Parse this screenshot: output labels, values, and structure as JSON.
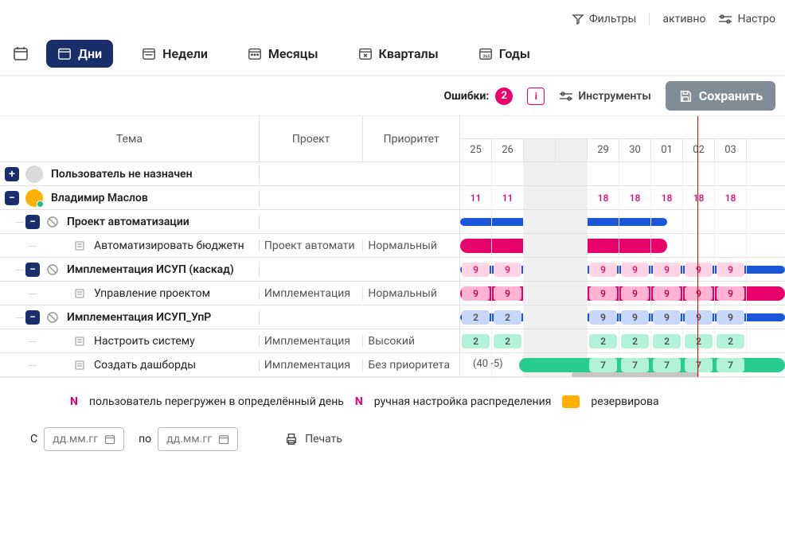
{
  "topbar": {
    "filters": "Фильтры",
    "active": "активно",
    "settings": "Настро"
  },
  "tabs": {
    "days": "Дни",
    "weeks": "Недели",
    "months": "Месяцы",
    "quarters": "Кварталы",
    "years": "Годы"
  },
  "toolrow": {
    "errors_label": "Ошибки:",
    "errors_count": "2",
    "tools": "Инструменты",
    "save": "Сохранить"
  },
  "headers": {
    "topic": "Тема",
    "project": "Проект",
    "priority": "Приоритет"
  },
  "days": [
    "25",
    "26",
    "",
    "",
    "29",
    "30",
    "01",
    "02",
    "03"
  ],
  "weekend_cols": [
    2,
    3
  ],
  "rows": {
    "r0": {
      "title": "Пользователь не назначен"
    },
    "r1": {
      "title": "Владимир Маслов",
      "alloc": [
        "11",
        "11",
        "",
        "",
        "18",
        "18",
        "18",
        "18",
        "18"
      ]
    },
    "r2": {
      "title": "Проект автоматизации"
    },
    "r3": {
      "title": "Автоматизировать бюджетн",
      "project": "Проект автомати",
      "priority": "Нормальный"
    },
    "r4": {
      "title": "Имплементация ИСУП (каскад)",
      "alloc": [
        "9",
        "9",
        "",
        "",
        "9",
        "9",
        "9",
        "9",
        "9"
      ]
    },
    "r5": {
      "title": "Управление проектом",
      "project": "Имплементация",
      "priority": "Нормальный",
      "alloc": [
        "9",
        "9",
        "",
        "",
        "9",
        "9",
        "9",
        "9",
        "9"
      ]
    },
    "r6": {
      "title": "Имплементация ИСУП_УпР",
      "alloc": [
        "2",
        "2",
        "",
        "",
        "9",
        "9",
        "9",
        "9",
        "9"
      ]
    },
    "r7": {
      "title": "Настроить систему",
      "project": "Имплементация",
      "priority": "Высокий",
      "alloc": [
        "2",
        "2",
        "",
        "",
        "2",
        "2",
        "2",
        "2",
        "2"
      ]
    },
    "r8": {
      "title": "Создать дашборды",
      "project": "Имплементация",
      "priority": "Без приоритета",
      "extra": "(40 -5)",
      "alloc": [
        "",
        "",
        "",
        "",
        "7",
        "7",
        "7",
        "7",
        "7"
      ]
    }
  },
  "legend": {
    "overload": "пользователь перегружен в определённый день",
    "manual": "ручная настройка распределения",
    "reserve": "резервирова"
  },
  "controls": {
    "from": "С",
    "to": "по",
    "placeholder": "дд.мм.гг",
    "print": "Печать"
  }
}
